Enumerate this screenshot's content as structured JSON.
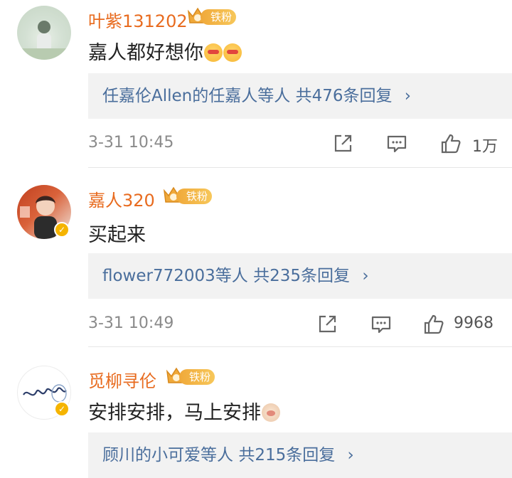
{
  "comments": [
    {
      "username": "叶紫131202",
      "fan_badge": {
        "label": "铁粉",
        "level": "1"
      },
      "text": "嘉人都好想你",
      "emoji": [
        "heart-eyes-emoji",
        "heart-eyes-emoji"
      ],
      "replies": {
        "users": "任嘉伦Allen的任嘉人等人",
        "count": "共476条回复",
        "chevron": "›"
      },
      "time": "3-31 10:45",
      "likes": "1万",
      "verified": false
    },
    {
      "username": "嘉人320",
      "fan_badge": {
        "label": "铁粉",
        "level": "2"
      },
      "text": "买起来",
      "emoji": [],
      "replies": {
        "users": "flower772003等人",
        "count": "共235条回复",
        "chevron": "›"
      },
      "time": "3-31 10:49",
      "likes": "9968",
      "verified": true
    },
    {
      "username": "觅柳寻伦",
      "fan_badge": {
        "label": "铁粉",
        "level": "5"
      },
      "text": "安排安排，马上安排",
      "emoji": [
        "pet-emoji"
      ],
      "replies": {
        "users": "顾川的小可爱等人",
        "count": "共215条回复",
        "chevron": "›"
      },
      "verified": true
    }
  ],
  "colors": {
    "username": "#e86b1f",
    "reply_link": "#4a6e9c",
    "badge": "#f0a93a",
    "verified": "#f5b400"
  }
}
